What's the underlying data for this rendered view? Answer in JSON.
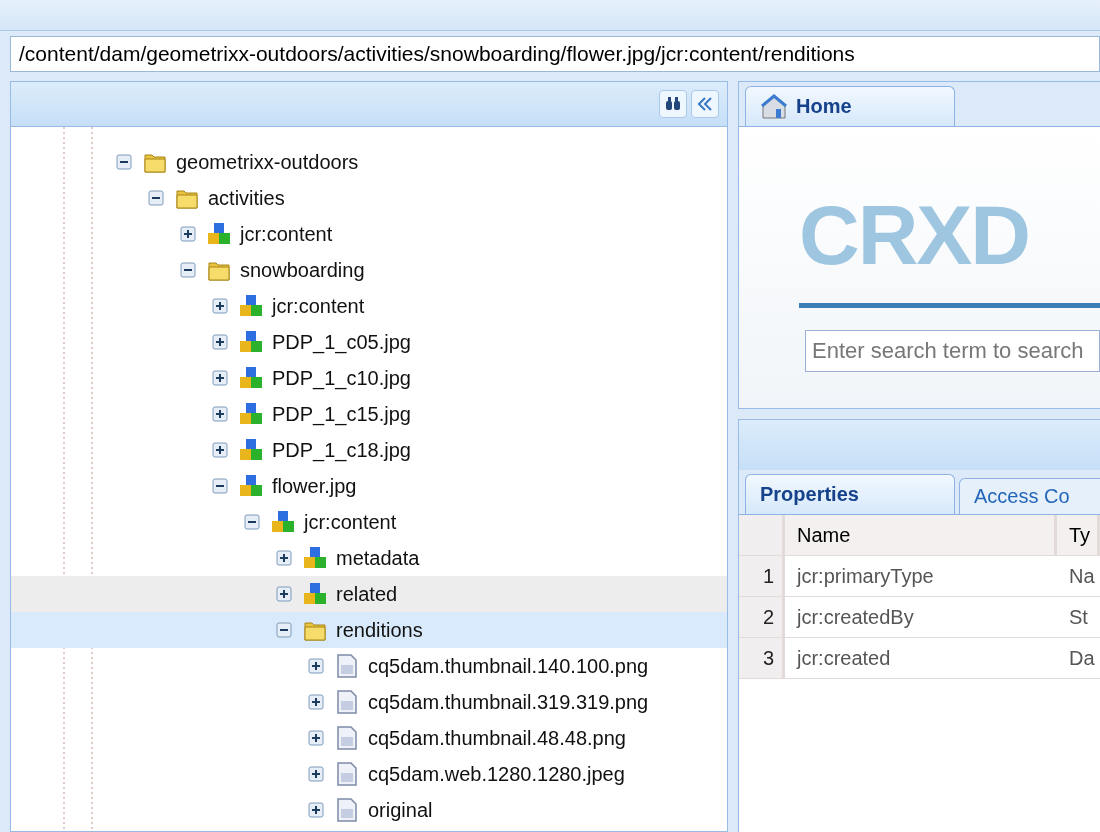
{
  "address_bar": {
    "value": "/content/dam/geometrixx-outdoors/activities/snowboarding/flower.jpg/jcr:content/renditions"
  },
  "tree": [
    {
      "label": "geometrixx-outdoors",
      "kind": "folder",
      "expanded": true,
      "selected": false,
      "hovered": false,
      "children": [
        {
          "label": "activities",
          "kind": "folder",
          "expanded": true,
          "selected": false,
          "hovered": false,
          "children": [
            {
              "label": "jcr:content",
              "kind": "node",
              "expanded": false,
              "selected": false,
              "hovered": false
            },
            {
              "label": "snowboarding",
              "kind": "folder",
              "expanded": true,
              "selected": false,
              "hovered": false,
              "children": [
                {
                  "label": "jcr:content",
                  "kind": "node",
                  "expanded": false,
                  "selected": false,
                  "hovered": false
                },
                {
                  "label": "PDP_1_c05.jpg",
                  "kind": "node",
                  "expanded": false,
                  "selected": false,
                  "hovered": false
                },
                {
                  "label": "PDP_1_c10.jpg",
                  "kind": "node",
                  "expanded": false,
                  "selected": false,
                  "hovered": false
                },
                {
                  "label": "PDP_1_c15.jpg",
                  "kind": "node",
                  "expanded": false,
                  "selected": false,
                  "hovered": false
                },
                {
                  "label": "PDP_1_c18.jpg",
                  "kind": "node",
                  "expanded": false,
                  "selected": false,
                  "hovered": false
                },
                {
                  "label": "flower.jpg",
                  "kind": "node",
                  "expanded": true,
                  "selected": false,
                  "hovered": false,
                  "children": [
                    {
                      "label": "jcr:content",
                      "kind": "node",
                      "expanded": true,
                      "selected": false,
                      "hovered": false,
                      "children": [
                        {
                          "label": "metadata",
                          "kind": "node",
                          "expanded": false,
                          "selected": false,
                          "hovered": false
                        },
                        {
                          "label": "related",
                          "kind": "node",
                          "expanded": false,
                          "selected": false,
                          "hovered": true
                        },
                        {
                          "label": "renditions",
                          "kind": "folder",
                          "expanded": true,
                          "selected": true,
                          "hovered": false,
                          "children": [
                            {
                              "label": "cq5dam.thumbnail.140.100.png",
                              "kind": "file",
                              "expanded": false,
                              "selected": false,
                              "hovered": false
                            },
                            {
                              "label": "cq5dam.thumbnail.319.319.png",
                              "kind": "file",
                              "expanded": false,
                              "selected": false,
                              "hovered": false
                            },
                            {
                              "label": "cq5dam.thumbnail.48.48.png",
                              "kind": "file",
                              "expanded": false,
                              "selected": false,
                              "hovered": false
                            },
                            {
                              "label": "cq5dam.web.1280.1280.jpeg",
                              "kind": "file",
                              "expanded": false,
                              "selected": false,
                              "hovered": false
                            },
                            {
                              "label": "original",
                              "kind": "file",
                              "expanded": false,
                              "selected": false,
                              "hovered": false
                            }
                          ]
                        }
                      ]
                    }
                  ]
                }
              ]
            }
          ]
        }
      ]
    }
  ],
  "home_tab": {
    "label": "Home",
    "logo": "CRXD",
    "search": {
      "placeholder": "Enter search term to search"
    }
  },
  "properties_tabs": [
    {
      "label": "Properties",
      "selected": true
    },
    {
      "label": "Access Co",
      "selected": false
    }
  ],
  "properties_table": {
    "columns": [
      "Name",
      "Ty"
    ],
    "rows": [
      {
        "index": "1",
        "name": "jcr:primaryType",
        "type": "Na"
      },
      {
        "index": "2",
        "name": "jcr:createdBy",
        "type": "St"
      },
      {
        "index": "3",
        "name": "jcr:created",
        "type": "Da"
      }
    ]
  }
}
